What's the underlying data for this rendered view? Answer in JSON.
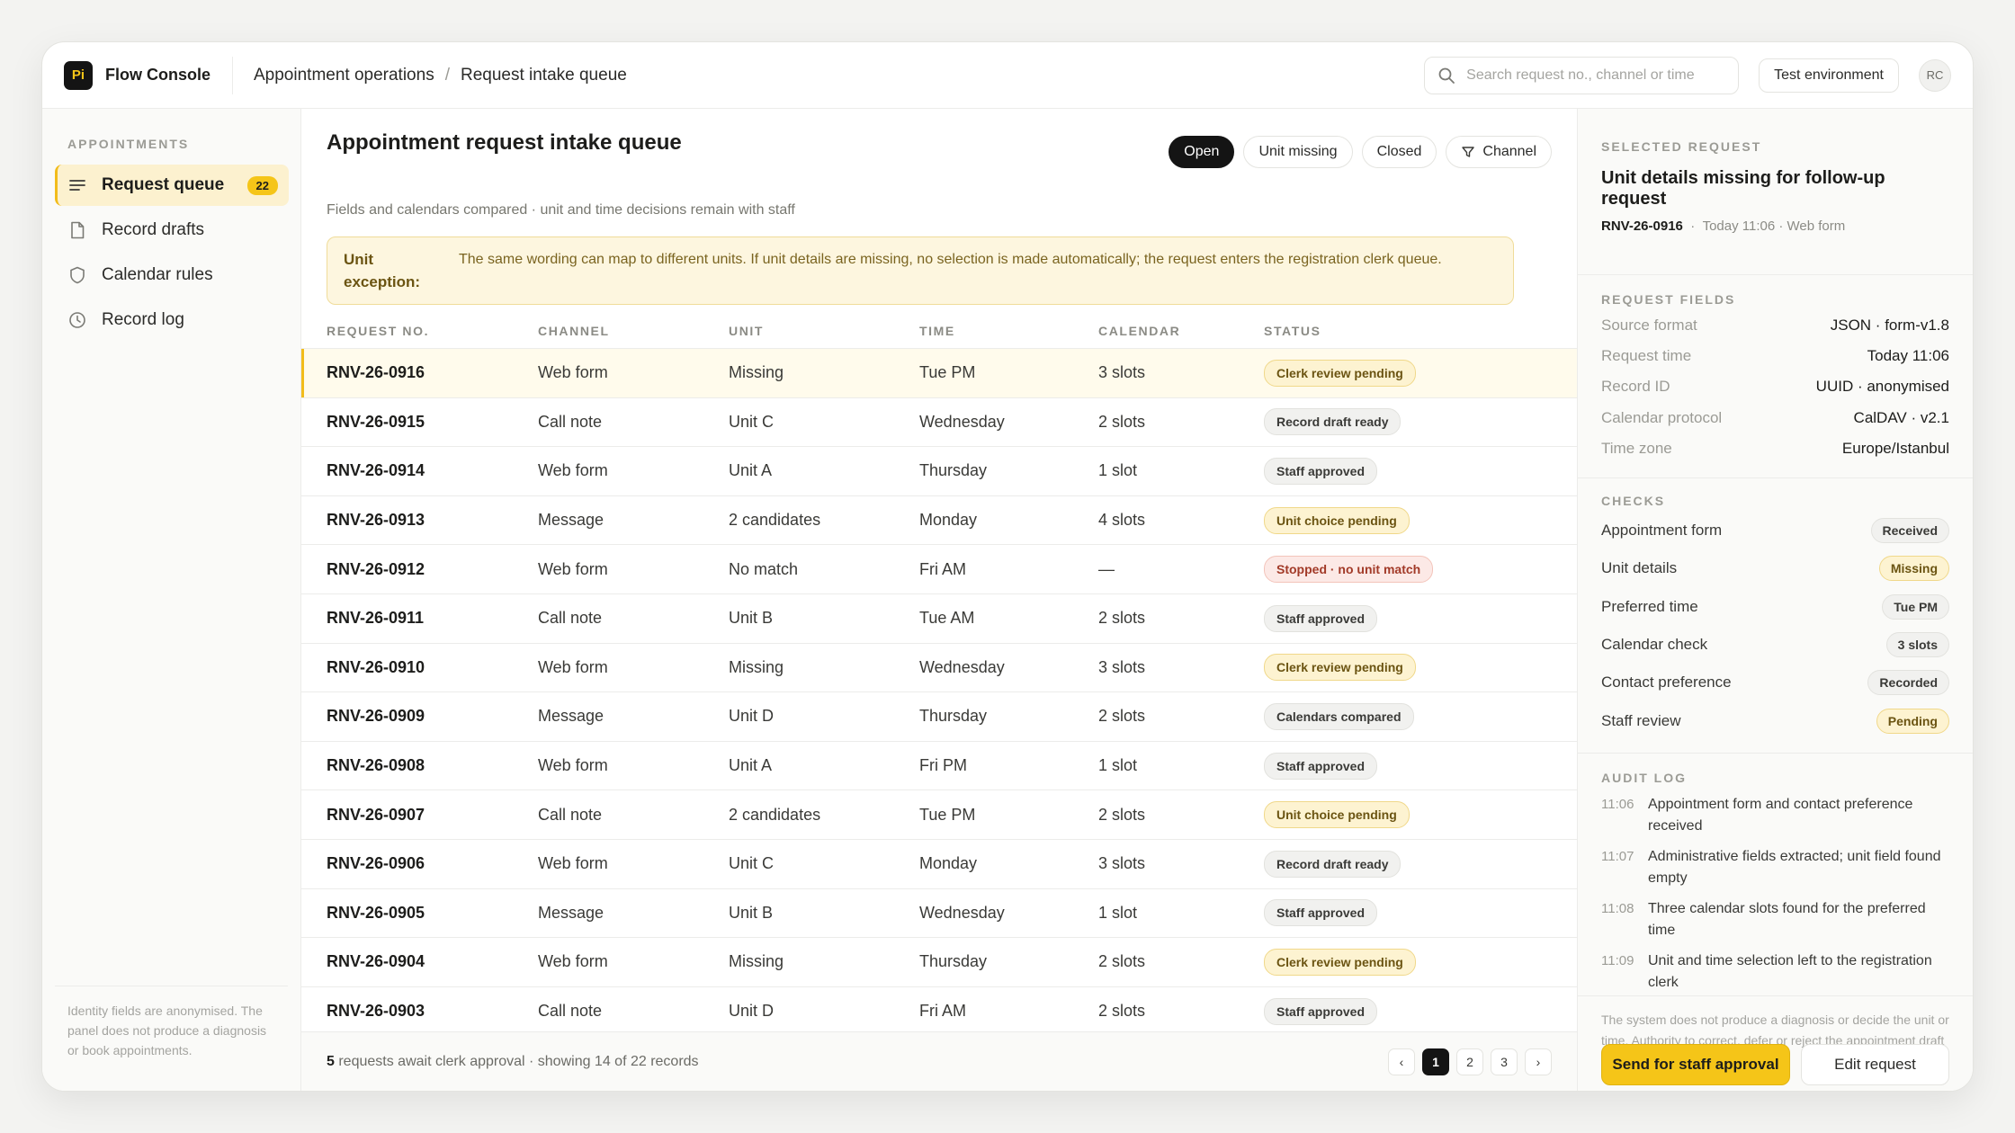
{
  "app": {
    "logo": "Pi",
    "name": "Flow Console"
  },
  "breadcrumb": [
    "Appointment operations",
    "Request intake queue"
  ],
  "breadcrumb_sep": "/",
  "search": {
    "placeholder": "Search request no., channel or time"
  },
  "env_label": "Test environment",
  "avatar": "RC",
  "sidebar": {
    "heading": "APPOINTMENTS",
    "items": [
      {
        "label": "Request queue",
        "badge": "22",
        "icon": "list-icon"
      },
      {
        "label": "Record drafts",
        "icon": "document-icon"
      },
      {
        "label": "Calendar rules",
        "icon": "shield-icon"
      },
      {
        "label": "Record log",
        "icon": "clock-icon"
      }
    ],
    "footer": "Identity fields are anonymised. The panel does not produce a diagnosis or book appointments."
  },
  "main": {
    "title": "Appointment request intake queue",
    "subtitle": "Fields and calendars compared · unit and time decisions remain with staff",
    "filters": [
      "Open",
      "Unit missing",
      "Closed",
      "Channel"
    ],
    "alert": {
      "label": "Unit exception:",
      "text": "The same wording can map to different units. If unit details are missing, no selection is made automatically; the request enters the registration clerk queue."
    },
    "columns": [
      "REQUEST NO.",
      "CHANNEL",
      "UNIT",
      "TIME",
      "CALENDAR",
      "STATUS"
    ],
    "rows": [
      {
        "id": "RNV-26-0916",
        "channel": "Web form",
        "unit": "Missing",
        "time": "Tue PM",
        "calendar": "3 slots",
        "status": "Clerk review pending",
        "tone": "warn"
      },
      {
        "id": "RNV-26-0915",
        "channel": "Call note",
        "unit": "Unit C",
        "time": "Wednesday",
        "calendar": "2 slots",
        "status": "Record draft ready",
        "tone": "gray"
      },
      {
        "id": "RNV-26-0914",
        "channel": "Web form",
        "unit": "Unit A",
        "time": "Thursday",
        "calendar": "1 slot",
        "status": "Staff approved",
        "tone": "gray"
      },
      {
        "id": "RNV-26-0913",
        "channel": "Message",
        "unit": "2 candidates",
        "time": "Monday",
        "calendar": "4 slots",
        "status": "Unit choice pending",
        "tone": "warn"
      },
      {
        "id": "RNV-26-0912",
        "channel": "Web form",
        "unit": "No match",
        "time": "Fri AM",
        "calendar": "—",
        "status": "Stopped · no unit match",
        "tone": "red"
      },
      {
        "id": "RNV-26-0911",
        "channel": "Call note",
        "unit": "Unit B",
        "time": "Tue AM",
        "calendar": "2 slots",
        "status": "Staff approved",
        "tone": "gray"
      },
      {
        "id": "RNV-26-0910",
        "channel": "Web form",
        "unit": "Missing",
        "time": "Wednesday",
        "calendar": "3 slots",
        "status": "Clerk review pending",
        "tone": "warn"
      },
      {
        "id": "RNV-26-0909",
        "channel": "Message",
        "unit": "Unit D",
        "time": "Thursday",
        "calendar": "2 slots",
        "status": "Calendars compared",
        "tone": "gray"
      },
      {
        "id": "RNV-26-0908",
        "channel": "Web form",
        "unit": "Unit A",
        "time": "Fri PM",
        "calendar": "1 slot",
        "status": "Staff approved",
        "tone": "gray"
      },
      {
        "id": "RNV-26-0907",
        "channel": "Call note",
        "unit": "2 candidates",
        "time": "Tue PM",
        "calendar": "2 slots",
        "status": "Unit choice pending",
        "tone": "warn"
      },
      {
        "id": "RNV-26-0906",
        "channel": "Web form",
        "unit": "Unit C",
        "time": "Monday",
        "calendar": "3 slots",
        "status": "Record draft ready",
        "tone": "gray"
      },
      {
        "id": "RNV-26-0905",
        "channel": "Message",
        "unit": "Unit B",
        "time": "Wednesday",
        "calendar": "1 slot",
        "status": "Staff approved",
        "tone": "gray"
      },
      {
        "id": "RNV-26-0904",
        "channel": "Web form",
        "unit": "Missing",
        "time": "Thursday",
        "calendar": "2 slots",
        "status": "Clerk review pending",
        "tone": "warn"
      },
      {
        "id": "RNV-26-0903",
        "channel": "Call note",
        "unit": "Unit D",
        "time": "Fri AM",
        "calendar": "2 slots",
        "status": "Staff approved",
        "tone": "gray"
      }
    ],
    "footer": {
      "count": "5",
      "text": " requests await clerk approval · showing 14 of 22 records"
    },
    "pager": {
      "prev": "‹",
      "pages": [
        "1",
        "2",
        "3"
      ],
      "next": "›"
    }
  },
  "panel": {
    "selected_heading": "SELECTED REQUEST",
    "selected_title": "Unit details missing for follow-up request",
    "selected_id": "RNV-26-0916",
    "selected_meta": "Today 11:06 · Web form",
    "fields_heading": "REQUEST FIELDS",
    "fields": [
      {
        "k": "Source format",
        "v": "JSON · form-v1.8"
      },
      {
        "k": "Request time",
        "v": "Today 11:06"
      },
      {
        "k": "Record ID",
        "v": "UUID · anonymised"
      },
      {
        "k": "Calendar protocol",
        "v": "CalDAV · v2.1"
      },
      {
        "k": "Time zone",
        "v": "Europe/Istanbul"
      }
    ],
    "checks_heading": "CHECKS",
    "checks": [
      {
        "k": "Appointment form",
        "v": "Received",
        "tone": "gray"
      },
      {
        "k": "Unit details",
        "v": "Missing",
        "tone": "warn"
      },
      {
        "k": "Preferred time",
        "v": "Tue PM",
        "tone": "gray"
      },
      {
        "k": "Calendar check",
        "v": "3 slots",
        "tone": "gray"
      },
      {
        "k": "Contact preference",
        "v": "Recorded",
        "tone": "gray"
      },
      {
        "k": "Staff review",
        "v": "Pending",
        "tone": "warn"
      }
    ],
    "audit_heading": "AUDIT LOG",
    "audit": [
      {
        "t": "11:06",
        "text": "Appointment form and contact preference received"
      },
      {
        "t": "11:07",
        "text": "Administrative fields extracted; unit field found empty"
      },
      {
        "t": "11:08",
        "text": "Three calendar slots found for the preferred time"
      },
      {
        "t": "11:09",
        "text": "Unit and time selection left to the registration clerk"
      }
    ],
    "note": "The system does not produce a diagnosis or decide the unit or time. Authority to correct, defer or reject the appointment draft remains with the clerk.",
    "primary_btn": "Send for staff approval",
    "secondary_btn": "Edit request"
  }
}
